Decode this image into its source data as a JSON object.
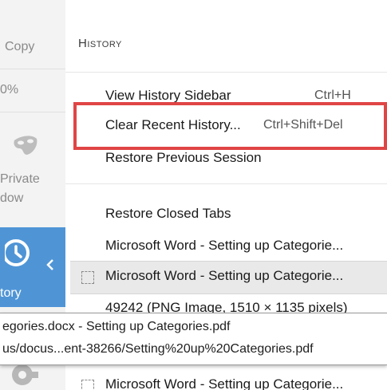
{
  "left_strip": {
    "copy_label": "Copy",
    "zoom_label": "0%",
    "private_label_line1": "Private",
    "private_label_line2": "dow",
    "history_label": "tory"
  },
  "panel": {
    "header_first": "H",
    "header_rest": "istory",
    "items": [
      {
        "label": "View History Sidebar",
        "shortcut": "Ctrl+H"
      },
      {
        "label": "Clear Recent History...",
        "shortcut": "Ctrl+Shift+Del"
      },
      {
        "label": "Restore Previous Session",
        "shortcut": ""
      },
      {
        "label": "Restore Closed Tabs",
        "shortcut": ""
      },
      {
        "label": "Microsoft Word - Setting up Categorie...",
        "shortcut": ""
      },
      {
        "label": "Microsoft Word - Setting up Categorie...",
        "shortcut": ""
      },
      {
        "label": "49242 (PNG Image, 1510 × 1135 pixels)",
        "shortcut": ""
      },
      {
        "label": "Microsoft Word - Setting up Categorie...",
        "shortcut": ""
      }
    ]
  },
  "tooltip": {
    "line1": "egories.docx - Setting up Categories.pdf",
    "line2": "us/docus...ent-38266/Setting%20up%20Categories.pdf"
  },
  "colors": {
    "highlight": "#e04545",
    "history_tile": "#4f95d6"
  },
  "icons": {
    "private": "private-browsing-mask-icon",
    "history": "history-clock-icon",
    "chevron": "chevron-left-icon",
    "settings": "gear-icon",
    "page": "page-placeholder-icon"
  }
}
